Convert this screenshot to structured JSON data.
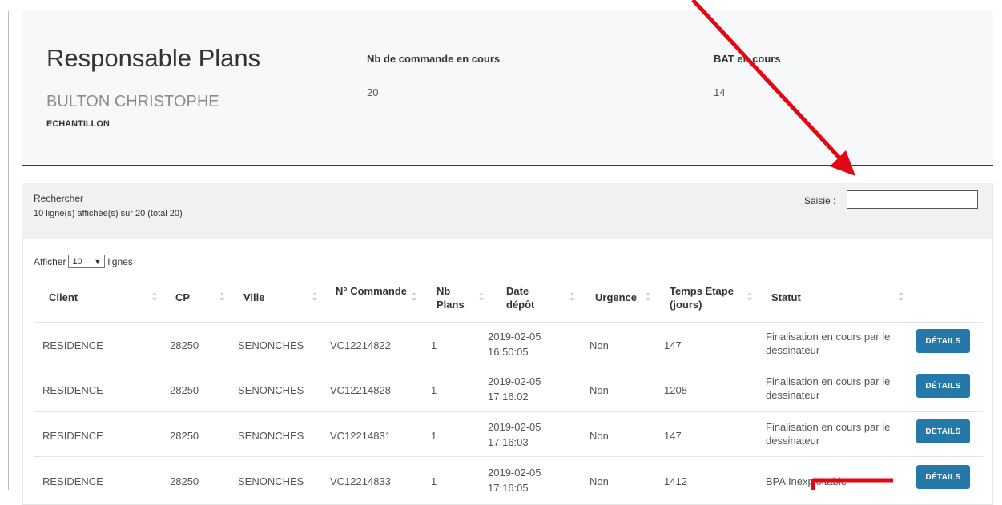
{
  "header": {
    "title": "Responsable Plans",
    "user_name": "BULTON CHRISTOPHE",
    "department": "ECHANTILLON",
    "stats": [
      {
        "label": "Nb de commande en cours",
        "value": "20"
      },
      {
        "label": "BAT en cours",
        "value": "14"
      }
    ]
  },
  "search": {
    "title": "Rechercher",
    "count_text": "10 ligne(s) affichée(s) sur 20 (total 20)",
    "input_label": "Saisie :",
    "input_value": ""
  },
  "pagination": {
    "prefix": "Afficher",
    "selected": "10",
    "suffix": "lignes"
  },
  "table": {
    "columns": [
      "Client",
      "CP",
      "Ville",
      "N° Commande",
      "Nb Plans",
      "Date dépôt",
      "Urgence",
      "Temps Etape (jours)",
      "Statut"
    ],
    "action_label": "DÉTAILS",
    "rows": [
      {
        "client": "RESIDENCE",
        "cp": "28250",
        "ville": "SENONCHES",
        "commande": "VC12214822",
        "plans": "1",
        "date": "2019-02-05",
        "time": "16:50:05",
        "urgence": "Non",
        "temps": "147",
        "statut": "Finalisation en cours par le dessinateur"
      },
      {
        "client": "RESIDENCE",
        "cp": "28250",
        "ville": "SENONCHES",
        "commande": "VC12214828",
        "plans": "1",
        "date": "2019-02-05",
        "time": "17:16:02",
        "urgence": "Non",
        "temps": "1208",
        "statut": "Finalisation en cours par le dessinateur"
      },
      {
        "client": "RESIDENCE",
        "cp": "28250",
        "ville": "SENONCHES",
        "commande": "VC12214831",
        "plans": "1",
        "date": "2019-02-05",
        "time": "17:16:03",
        "urgence": "Non",
        "temps": "147",
        "statut": "Finalisation en cours par le dessinateur"
      },
      {
        "client": "RESIDENCE",
        "cp": "28250",
        "ville": "SENONCHES",
        "commande": "VC12214833",
        "plans": "1",
        "date": "2019-02-05",
        "time": "17:16:05",
        "urgence": "Non",
        "temps": "1412",
        "statut": "BPA Inexploitable"
      }
    ]
  },
  "colors": {
    "accent": "#2579a9",
    "annotation": "#e30613"
  }
}
